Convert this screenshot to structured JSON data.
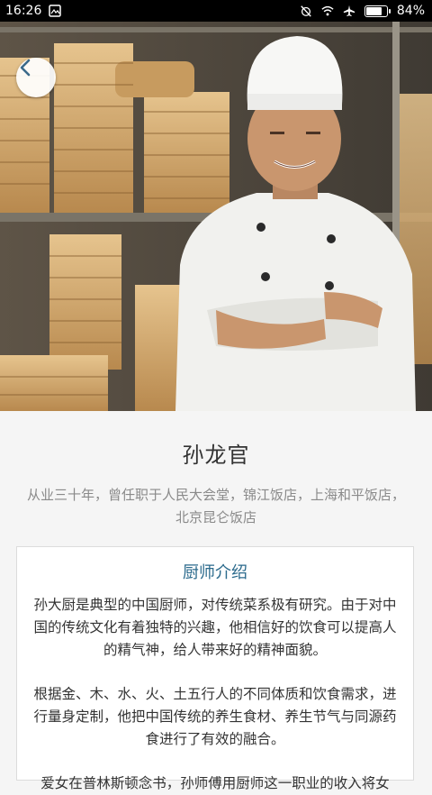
{
  "status": {
    "time": "16:26",
    "battery_percent": "84%",
    "battery_level": 0.84
  },
  "header": {
    "back_icon": "chevron-left-icon"
  },
  "chef": {
    "name": "孙龙官",
    "bio": "从业三十年，曾任职于人民大会堂，锦江饭店，上海和平饭店，北京昆仑饭店"
  },
  "intro": {
    "title": "厨师介绍",
    "paragraphs": [
      "孙大厨是典型的中国厨师，对传统菜系极有研究。由于对中国的传统文化有着独特的兴趣，他相信好的饮食可以提高人的精气神，给人带来好的精神面貌。",
      "根据金、木、水、火、土五行人的不同体质和饮食需求，进行量身定制，他把中国传统的养生食材、养生节气与同源药食进行了有效的融合。",
      "爱女在普林斯顿念书，孙师傅用厨师这一职业的收入将女"
    ]
  },
  "colors": {
    "accent": "#2b6a8c",
    "background": "#f5f5f5"
  }
}
